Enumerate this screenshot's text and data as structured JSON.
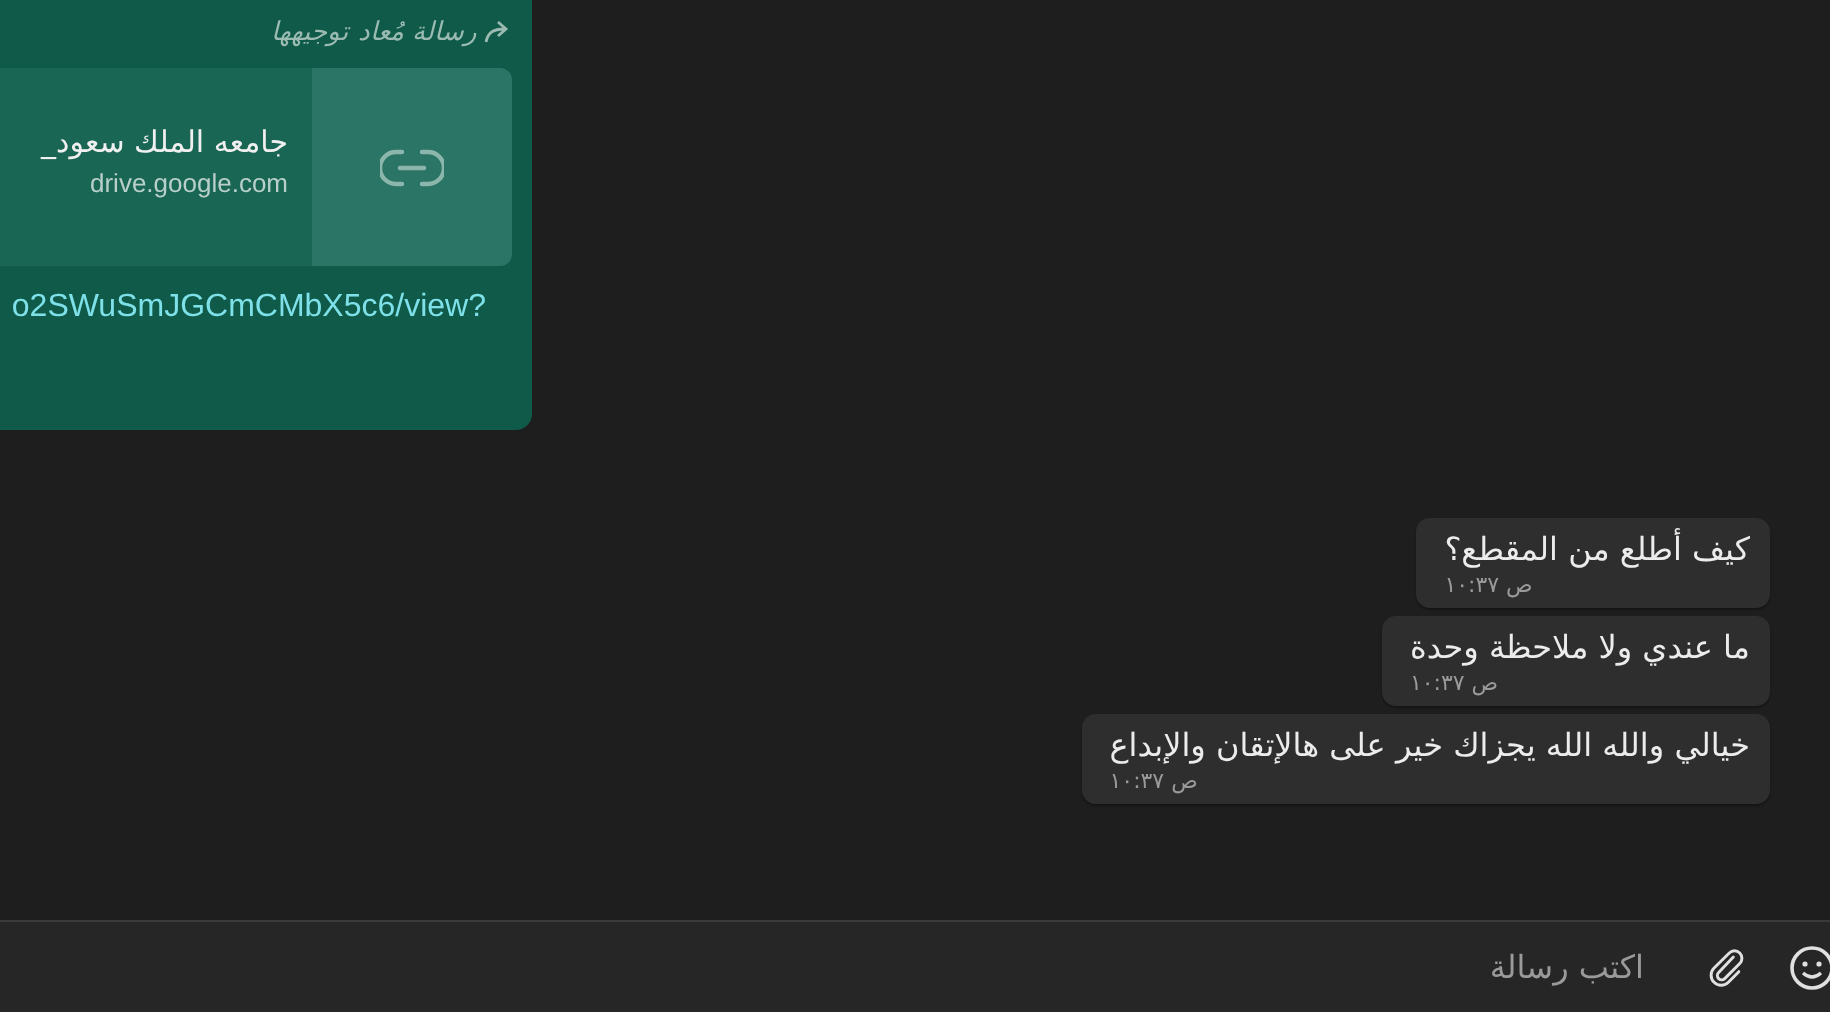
{
  "forwarded_message": {
    "forwarded_label": "رسالة مُعاد توجيهها",
    "link_preview": {
      "title": "جامعه الملك سعود_",
      "domain": "drive.google.com"
    },
    "url": "o2SWuSmJGCmCMbX5c6/view?"
  },
  "messages": [
    {
      "text": "كيف أطلع من المقطع؟",
      "time": "ص ١٠:٣٧"
    },
    {
      "text": "ما عندي ولا ملاحظة وحدة",
      "time": "ص ١٠:٣٧"
    },
    {
      "text": "خيالي والله الله يجزاك خير على هالإتقان والإبداع",
      "time": "ص ١٠:٣٧"
    }
  ],
  "composer": {
    "placeholder": "اكتب رسالة"
  }
}
